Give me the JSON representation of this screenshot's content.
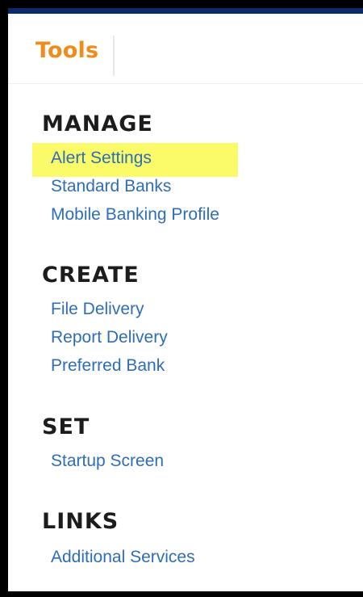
{
  "header": {
    "tab_label": "Tools"
  },
  "sections": [
    {
      "heading": "MANAGE",
      "links": [
        "Alert Settings",
        "Standard Banks",
        "Mobile Banking Profile"
      ]
    },
    {
      "heading": "CREATE",
      "links": [
        "File Delivery",
        "Report Delivery",
        "Preferred Bank"
      ]
    },
    {
      "heading": "SET",
      "links": [
        "Startup Screen"
      ]
    },
    {
      "heading": "LINKS",
      "links": [
        "Additional Services"
      ]
    }
  ],
  "highlighted_item": "Alert Settings",
  "colors": {
    "tab_accent": "#f08c1b",
    "link": "#2e6db8",
    "highlight": "#fbfb69",
    "top_bar": "#0a2b6b"
  }
}
